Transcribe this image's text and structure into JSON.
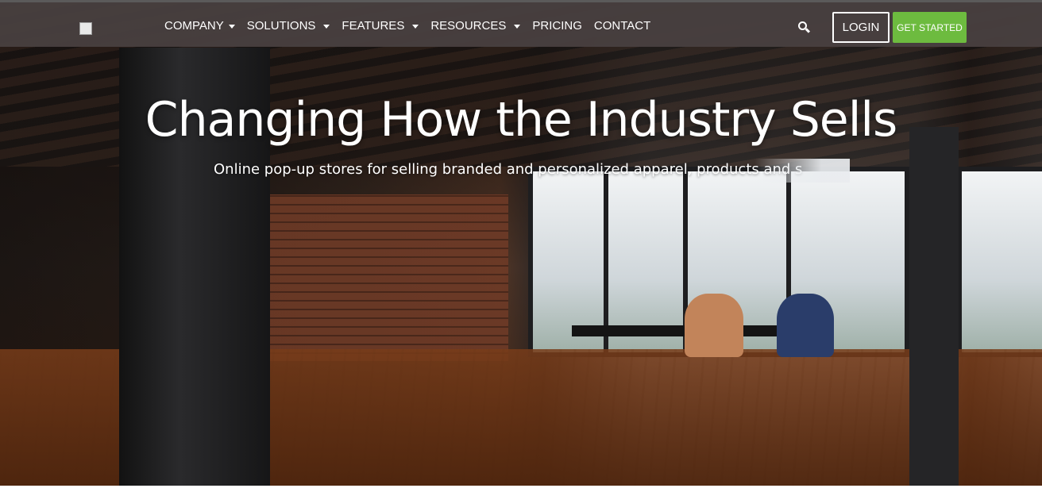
{
  "nav": {
    "items": [
      {
        "label": "COMPANY",
        "dropdown": true
      },
      {
        "label": "SOLUTIONS",
        "dropdown": true
      },
      {
        "label": "FEATURES",
        "dropdown": true
      },
      {
        "label": "RESOURCES",
        "dropdown": true
      },
      {
        "label": "PRICING",
        "dropdown": false
      },
      {
        "label": "CONTACT",
        "dropdown": false
      }
    ],
    "search_icon": "search-icon",
    "login_label": "LOGIN",
    "cta_label": "GET STARTED"
  },
  "hero": {
    "headline": "Changing How the Industry Sells",
    "subheadline": "Online pop-up stores for selling branded and personalized apparel, products and s"
  },
  "colors": {
    "navbar": "#483f3f",
    "cta": "#6dbb3f",
    "text": "#ffffff"
  }
}
